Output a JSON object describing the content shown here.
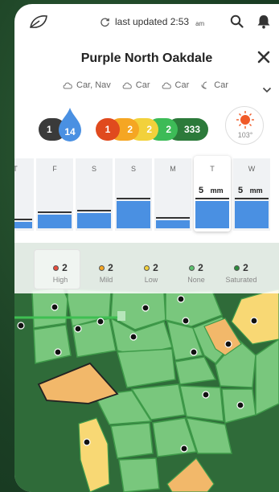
{
  "header": {
    "updated_text": "last updated 2:53",
    "updated_ampm": "am"
  },
  "title": "Purple North Oakdale",
  "forecast": [
    {
      "label": "Car, Nav",
      "icon": "cloud-icon"
    },
    {
      "label": "Car",
      "icon": "cloud-icon"
    },
    {
      "label": "Car",
      "icon": "cloud-icon"
    },
    {
      "label": "Car",
      "icon": "moon-icon"
    }
  ],
  "summary": {
    "dark_count": "1",
    "drop_count": "14",
    "status_counts": [
      "1",
      "2",
      "2",
      "2",
      "333"
    ],
    "temperature": "103°"
  },
  "rainfall": {
    "days": [
      "T",
      "F",
      "S",
      "S",
      "M",
      "T",
      "W"
    ],
    "today_index": 5,
    "amounts_mm": [
      0.5,
      1.0,
      1.1,
      2.0,
      0.6,
      2.0,
      2.0
    ],
    "today_value": "5",
    "next_value": "5",
    "unit": "mm"
  },
  "legend": [
    {
      "count": "2",
      "label": "High",
      "color": "#e74c3c"
    },
    {
      "count": "2",
      "label": "Mild",
      "color": "#f5a623"
    },
    {
      "count": "2",
      "label": "Low",
      "color": "#f2d13b"
    },
    {
      "count": "2",
      "label": "None",
      "color": "#5cc36e"
    },
    {
      "count": "2",
      "label": "Saturated",
      "color": "#2c8c3c"
    }
  ],
  "colors": {
    "accent_blue": "#4a90e2",
    "dark": "#333333",
    "red": "#e04a1e",
    "orange": "#f5a623",
    "yellow": "#f2d13b",
    "green": "#3dbb57",
    "dark_green": "#2c8c3c",
    "field_green": "#79c77d",
    "field_orange": "#f2b86a",
    "field_yellow": "#f8d874"
  }
}
